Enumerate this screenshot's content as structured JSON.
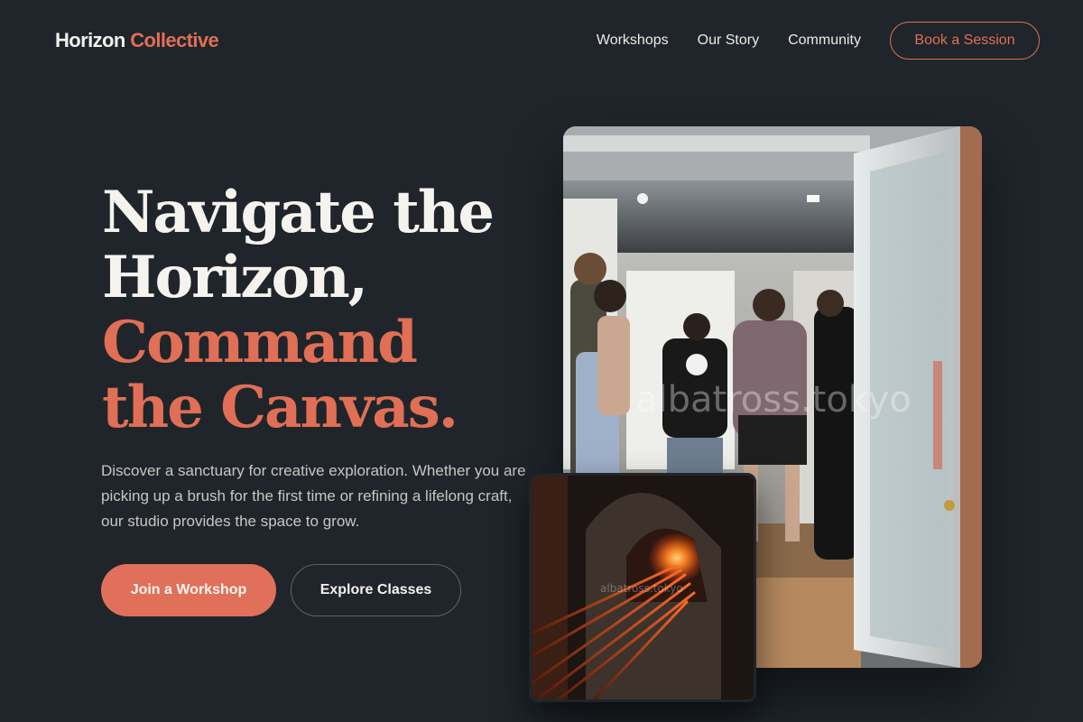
{
  "header": {
    "logo_part1": "Horizon",
    "logo_part2": "Collective",
    "nav": [
      "Workshops",
      "Our Story",
      "Community"
    ],
    "cta_label": "Book a Session"
  },
  "hero": {
    "headline_line1": "Navigate the",
    "headline_line2": "Horizon,",
    "headline_line3": "Command",
    "headline_line4": "the Canvas.",
    "lead": "Discover a sanctuary for creative exploration. Whether you are picking up a brush for the first time or refining a lifelong craft, our studio provides the space to grow.",
    "primary_button": "Join a Workshop",
    "secondary_button": "Explore Classes"
  },
  "images": {
    "main_watermark": "albatross.tokyo",
    "inset_watermark": "albatross.tokyo"
  },
  "colors": {
    "background": "#1f252b",
    "accent": "#e06f55",
    "text": "#f4f1ec"
  }
}
